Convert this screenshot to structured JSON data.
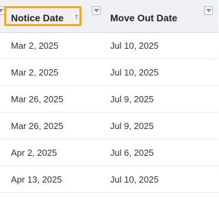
{
  "table": {
    "columns": [
      {
        "label": "Notice Date",
        "sort": "ascending"
      },
      {
        "label": "Move Out Date"
      }
    ],
    "sort_glyph": "↑",
    "rows": [
      {
        "notice_date": "Mar 2, 2025",
        "move_out_date": "Jul 10, 2025"
      },
      {
        "notice_date": "Mar 2, 2025",
        "move_out_date": "Jul 10, 2025"
      },
      {
        "notice_date": "Mar 26, 2025",
        "move_out_date": "Jul 9, 2025"
      },
      {
        "notice_date": "Mar 26, 2025",
        "move_out_date": "Jul 9, 2025"
      },
      {
        "notice_date": "Apr 2, 2025",
        "move_out_date": "Jul 6, 2025"
      },
      {
        "notice_date": "Apr 13, 2025",
        "move_out_date": "Jul 10, 2025"
      }
    ]
  },
  "colors": {
    "header_bg": "#eef0f3",
    "focus_outline": "#f5a623",
    "row_divider": "#e6e8eb"
  },
  "icons": [
    "filter-icon",
    "sort-ascending-icon"
  ]
}
